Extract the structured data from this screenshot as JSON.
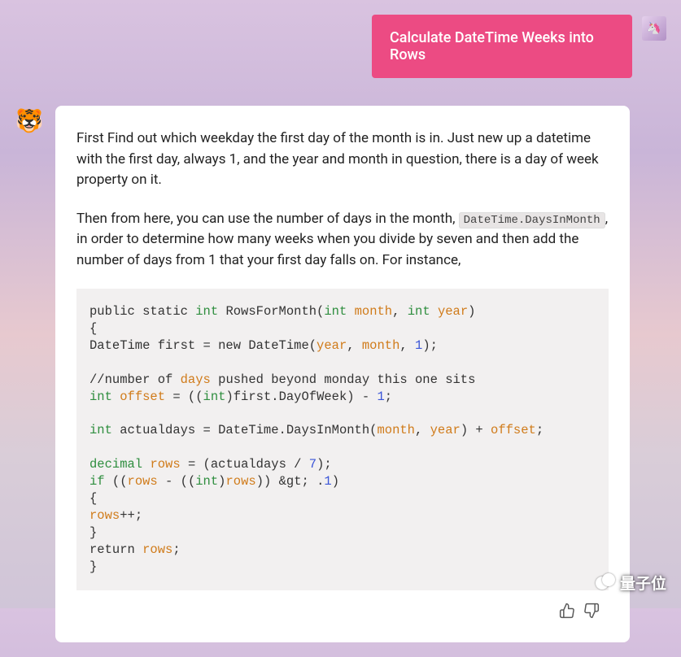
{
  "user": {
    "message": "Calculate DateTime Weeks into Rows",
    "avatar_emoji": "🦄"
  },
  "assistant": {
    "avatar_emoji": "🐯",
    "paragraph1": "First Find out which weekday the first day of the month is in. Just new up a datetime with the first day, always 1, and the year and month in question, there is a day of week property on it.",
    "paragraph2_prefix": "Then from here, you can use the number of days in the month, ",
    "paragraph2_inline_code": "DateTime.DaysInMonth",
    "paragraph2_suffix": ", in order to determine how many weeks when you divide by seven and then add the number of days from 1 that your first day falls on. For instance,",
    "code": {
      "l1_a": "public static ",
      "l1_kw1": "int",
      "l1_b": " RowsForMonth(",
      "l1_kw2": "int",
      "l1_c": " ",
      "l1_v1": "month",
      "l1_d": ", ",
      "l1_kw3": "int",
      "l1_e": " ",
      "l1_v2": "year",
      "l1_f": ")",
      "l2": "{",
      "l3_a": "DateTime first = new DateTime(",
      "l3_v1": "year",
      "l3_b": ", ",
      "l3_v2": "month",
      "l3_c": ", ",
      "l3_n1": "1",
      "l3_d": ");",
      "l5_a": "//number of ",
      "l5_v1": "days",
      "l5_b": " pushed beyond monday this one sits",
      "l6_kw1": "int",
      "l6_a": " ",
      "l6_v1": "offset",
      "l6_b": " = ((",
      "l6_kw2": "int",
      "l6_c": ")first.DayOfWeek) - ",
      "l6_n1": "1",
      "l6_d": ";",
      "l8_kw1": "int",
      "l8_a": " actualdays = DateTime.DaysInMonth(",
      "l8_v1": "month",
      "l8_b": ", ",
      "l8_v2": "year",
      "l8_c": ") + ",
      "l8_v3": "offset",
      "l8_d": ";",
      "l10_kw1": "decimal",
      "l10_a": " ",
      "l10_v1": "rows",
      "l10_b": " = (actualdays / ",
      "l10_n1": "7",
      "l10_c": ");",
      "l11_kw1": "if",
      "l11_a": " ((",
      "l11_v1": "rows",
      "l11_b": " - ((",
      "l11_kw2": "int",
      "l11_c": ")",
      "l11_v2": "rows",
      "l11_d": ")) &gt; .",
      "l11_n1": "1",
      "l11_e": ")",
      "l12": "{",
      "l13_v1": "rows",
      "l13_a": "++;",
      "l14": "}",
      "l15_a": "return ",
      "l15_v1": "rows",
      "l15_b": ";",
      "l16": "}"
    }
  },
  "watermark": {
    "text": "量子位"
  }
}
